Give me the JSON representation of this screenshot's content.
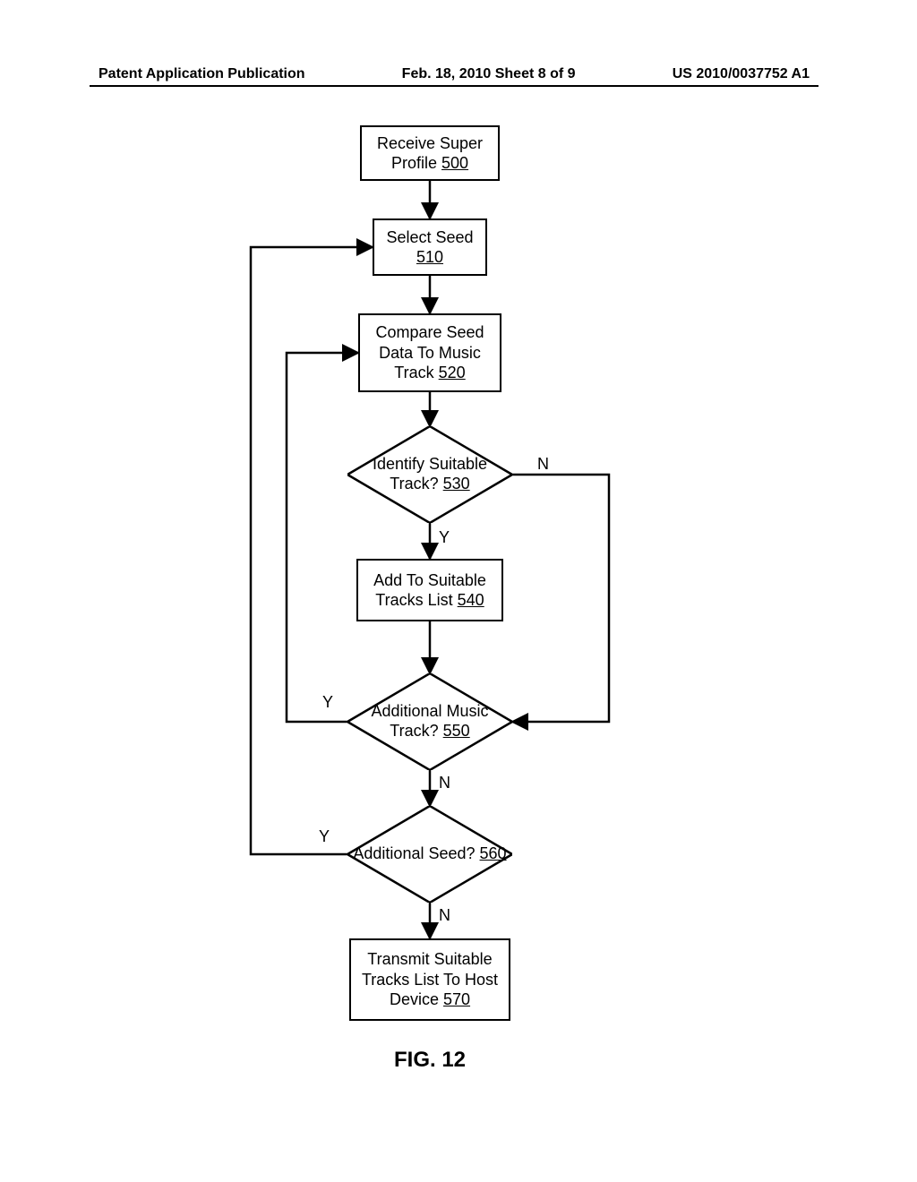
{
  "header": {
    "left": "Patent Application Publication",
    "center": "Feb. 18, 2010  Sheet 8 of 9",
    "right": "US 2010/0037752 A1"
  },
  "figure_label": "FIG. 12",
  "nodes": {
    "n500": {
      "text": "Receive Super Profile",
      "ref": "500"
    },
    "n510": {
      "text": "Select Seed",
      "ref": "510"
    },
    "n520": {
      "text": "Compare Seed Data To Music Track",
      "ref": "520"
    },
    "n530": {
      "text": "Identify Suitable Track?",
      "ref": "530"
    },
    "n540": {
      "text": "Add To Suitable Tracks List",
      "ref": "540"
    },
    "n550": {
      "text": "Additional Music Track?",
      "ref": "550"
    },
    "n560": {
      "text": "Additional Seed?",
      "ref": "560"
    },
    "n570": {
      "text": "Transmit Suitable Tracks List To Host Device",
      "ref": "570"
    }
  },
  "labels": {
    "y": "Y",
    "n": "N"
  }
}
